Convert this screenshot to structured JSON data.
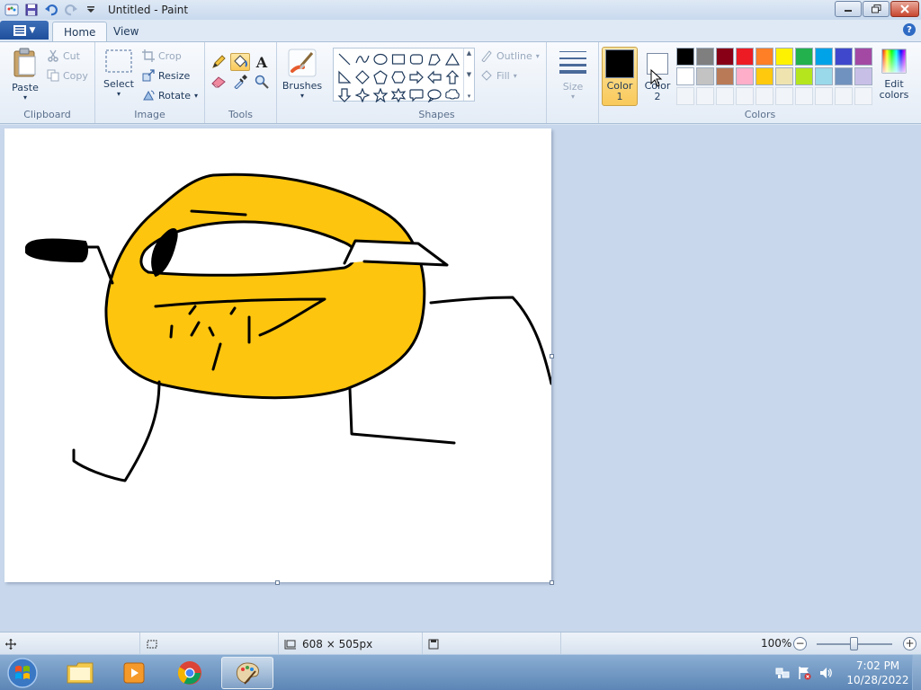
{
  "window": {
    "title": "Untitled - Paint"
  },
  "tabs": [
    {
      "label": "Home",
      "active": true
    },
    {
      "label": "View",
      "active": false
    }
  ],
  "clipboard": {
    "group_label": "Clipboard",
    "paste": "Paste",
    "cut": "Cut",
    "copy": "Copy"
  },
  "image": {
    "group_label": "Image",
    "select": "Select",
    "crop": "Crop",
    "resize": "Resize",
    "rotate": "Rotate"
  },
  "tools": {
    "group_label": "Tools"
  },
  "brushes": {
    "label": "Brushes"
  },
  "shapes": {
    "group_label": "Shapes",
    "outline": "Outline",
    "fill": "Fill"
  },
  "size": {
    "label": "Size"
  },
  "colors": {
    "group_label": "Colors",
    "color1_line1": "Color",
    "color1_line2": "1",
    "color2_line1": "Color",
    "color2_line2": "2",
    "edit_line1": "Edit",
    "edit_line2": "colors",
    "color1_value": "#000000",
    "color2_value": "#ffffff",
    "palette_row1": [
      "#000000",
      "#7f7f7f",
      "#880015",
      "#ed1c24",
      "#ff7f27",
      "#fff200",
      "#22b14c",
      "#00a2e8",
      "#3f48cc",
      "#a349a4"
    ],
    "palette_row2": [
      "#ffffff",
      "#c3c3c3",
      "#b97a57",
      "#ffaec9",
      "#ffc90e",
      "#efe4b0",
      "#b5e61d",
      "#99d9ea",
      "#7092be",
      "#c8bfe7"
    ]
  },
  "status": {
    "dimensions": "608 × 505px",
    "zoom": "100%"
  },
  "taskbar": {
    "time": "7:02 PM",
    "date": "10/28/2022"
  },
  "drawing_colors": {
    "fill": "#fdc50e",
    "stroke": "#000000"
  }
}
